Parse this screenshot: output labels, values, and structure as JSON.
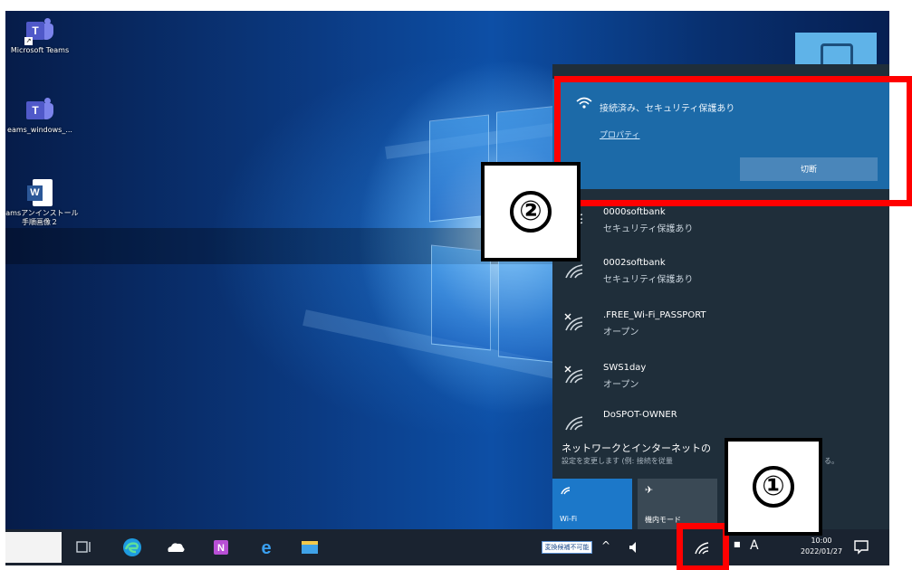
{
  "desktop": {
    "icons": [
      {
        "name": "teams-icon",
        "label": "Microsoft Teams"
      },
      {
        "name": "teams-icon",
        "label": "eams_windows_..."
      },
      {
        "name": "word-doc-icon",
        "label": "eamsアンインストール\n手順画像２"
      }
    ]
  },
  "network_flyout": {
    "connected": {
      "status": "接続済み、セキュリティ保護あり",
      "properties_link": "プロパティ",
      "disconnect_button": "切断"
    },
    "networks": [
      {
        "ssid": "0000softbank",
        "security": "セキュリティ保護あり",
        "icon": "wifi-secured-icon"
      },
      {
        "ssid": "0002softbank",
        "security": "セキュリティ保護あり",
        "icon": "wifi-secured-icon"
      },
      {
        "ssid": ".FREE_Wi-Fi_PASSPORT",
        "security": "オープン",
        "icon": "wifi-open-icon"
      },
      {
        "ssid": "SWS1day",
        "security": "オープン",
        "icon": "wifi-open-icon"
      },
      {
        "ssid": "DoSPOT-OWNER",
        "security": "",
        "icon": "wifi-secured-icon"
      }
    ],
    "settings": {
      "title": "ネットワークとインターネットの",
      "subtitle": "設定を変更します (例: 接続を従量",
      "tail": "る。"
    },
    "quick_actions": [
      {
        "label": "Wi-Fi",
        "icon": "wifi-icon",
        "active": true
      },
      {
        "label": "機内モード",
        "icon": "airplane-icon",
        "active": false
      }
    ]
  },
  "taskbar": {
    "ime_status": "変換候補不可能",
    "ime_mode": "A",
    "clock": {
      "time": "10:00",
      "date": "2022/01/27"
    }
  },
  "annotations": {
    "step1": "①",
    "step2": "②"
  },
  "colors": {
    "accent": "#1c6aa8",
    "annotation_red": "#ff0000",
    "flyout_bg": "#1f2e3a"
  }
}
